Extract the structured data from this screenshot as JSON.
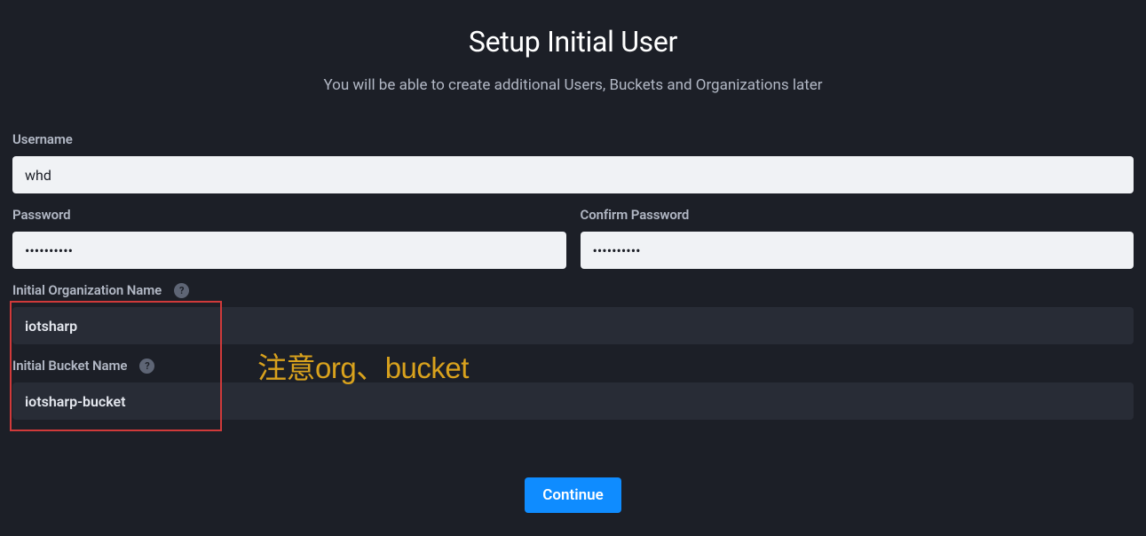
{
  "header": {
    "title": "Setup Initial User",
    "subtitle": "You will be able to create additional Users, Buckets and Organizations later"
  },
  "form": {
    "username": {
      "label": "Username",
      "value": "whd"
    },
    "password": {
      "label": "Password",
      "value": "••••••••••"
    },
    "confirm_password": {
      "label": "Confirm Password",
      "value": "••••••••••"
    },
    "org": {
      "label": "Initial Organization Name",
      "value": "iotsharp"
    },
    "bucket": {
      "label": "Initial Bucket Name",
      "value": "iotsharp-bucket"
    }
  },
  "buttons": {
    "continue": "Continue"
  },
  "annotation": {
    "text": "注意org、bucket"
  },
  "help_glyph": "?"
}
